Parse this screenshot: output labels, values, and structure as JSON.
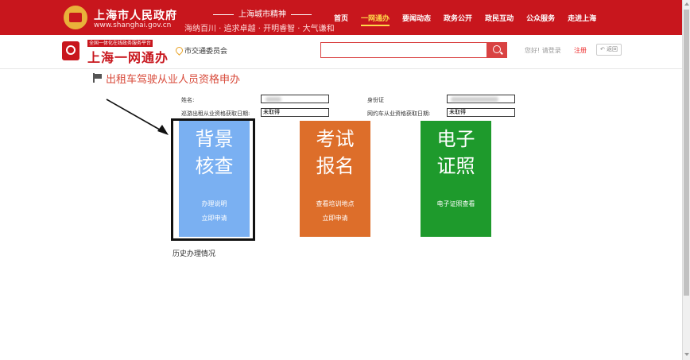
{
  "top_header": {
    "gov_title": "上海市人民政府",
    "gov_url": "www.shanghai.gov.cn",
    "spirit_title": "上海城市精神",
    "spirit_text": "海纳百川 · 追求卓越 · 开明睿智 · 大气谦和",
    "nav": [
      "首页",
      "一网通办",
      "要闻动态",
      "政务公开",
      "政民互动",
      "公众服务",
      "走进上海"
    ],
    "nav_active": "一网通办"
  },
  "sub_header": {
    "platform_tag": "全国一体化在线政务服务平台",
    "app_name": "上海一网通办",
    "location": "市交通委员会",
    "search_placeholder": "",
    "greeting": "您好! 请登录",
    "register": "注册",
    "back": "返回"
  },
  "page": {
    "title": "出租车驾驶从业人员资格申办",
    "form": {
      "name_label": "姓名:",
      "id_label": "身份证",
      "taxi_cert_label": "巡游出租从业资格获取日期:",
      "taxi_cert_value": "未取得",
      "ride_cert_label": "网约车从业资格获取日期:",
      "ride_cert_value": "未取得"
    },
    "tiles": [
      {
        "title_line1": "背景",
        "title_line2": "核查",
        "link1": "办理说明",
        "link2": "立即申请",
        "color": "#7ab0f2"
      },
      {
        "title_line1": "考试",
        "title_line2": "报名",
        "link1": "查看培训地点",
        "link2": "立即申请",
        "color": "#dd6e2a"
      },
      {
        "title_line1": "电子",
        "title_line2": "证照",
        "link1": "电子证照查看",
        "link2": "",
        "color": "#1e9a2c"
      }
    ],
    "history": "历史办理情况"
  },
  "colors": {
    "brand_red": "#c8161d",
    "search_red": "#d94242",
    "title_red": "#d84a3a",
    "nav_active": "#ffd84a"
  }
}
